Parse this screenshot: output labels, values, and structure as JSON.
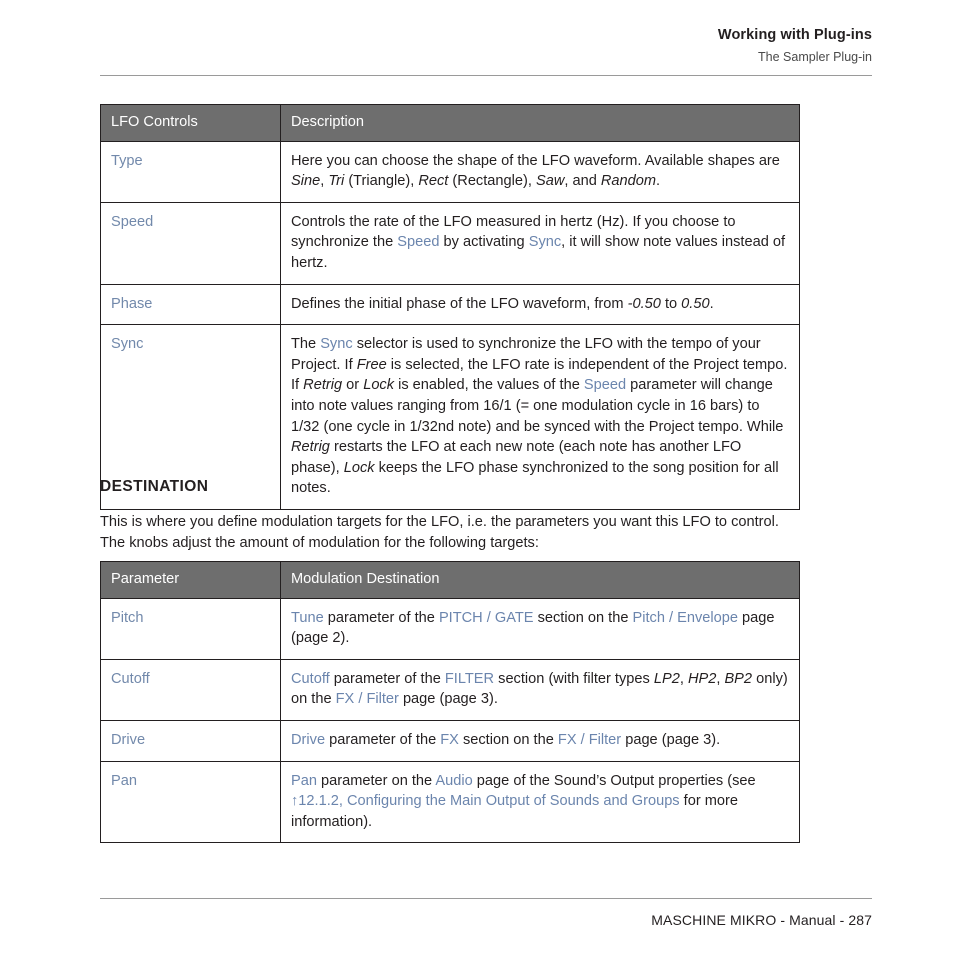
{
  "header": {
    "title": "Working with Plug-ins",
    "subtitle": "The Sampler Plug-in"
  },
  "colors": {
    "table_header_bg": "#6e6e6e",
    "table_header_text": "#ffffff",
    "link": "#6b85ad",
    "parameter": "#7289ab",
    "body_text": "#231f20",
    "rule": "#9a9a9a"
  },
  "lfo_table": {
    "headers": [
      "LFO Controls",
      "Description"
    ],
    "rows": [
      {
        "key": "Type",
        "desc_plain": "Here you can choose the shape of the LFO waveform. Available shapes are Sine, Tri (Triangle), Rect (Rectangle), Saw, and Random.",
        "parts": [
          {
            "t": "Here you can choose the shape of the LFO waveform. Available shapes are ",
            "s": "plain"
          },
          {
            "t": "Sine",
            "s": "italic"
          },
          {
            "t": ", ",
            "s": "plain"
          },
          {
            "t": "Tri",
            "s": "italic"
          },
          {
            "t": " (Triangle), ",
            "s": "plain"
          },
          {
            "t": "Rect",
            "s": "italic"
          },
          {
            "t": " (Rectangle), ",
            "s": "plain"
          },
          {
            "t": "Saw",
            "s": "italic"
          },
          {
            "t": ", and ",
            "s": "plain"
          },
          {
            "t": "Random",
            "s": "italic"
          },
          {
            "t": ".",
            "s": "plain"
          }
        ]
      },
      {
        "key": "Speed",
        "desc_plain": "Controls the rate of the LFO measured in hertz (Hz). If you choose to synchronize the Speed by activating Sync, it will show note values instead of hertz.",
        "parts": [
          {
            "t": "Controls the rate of the LFO measured in hertz (Hz). If you choose to synchronize the ",
            "s": "plain"
          },
          {
            "t": "Speed",
            "s": "link"
          },
          {
            "t": " by activating ",
            "s": "plain"
          },
          {
            "t": "Sync",
            "s": "link"
          },
          {
            "t": ", it will show note values instead of hertz.",
            "s": "plain"
          }
        ]
      },
      {
        "key": "Phase",
        "desc_plain": "Defines the initial phase of the LFO waveform, from -0.50 to 0.50.",
        "parts": [
          {
            "t": "Defines the initial phase of the LFO waveform, from ",
            "s": "plain"
          },
          {
            "t": "-0.50",
            "s": "italic"
          },
          {
            "t": " to ",
            "s": "plain"
          },
          {
            "t": "0.50",
            "s": "italic"
          },
          {
            "t": ".",
            "s": "plain"
          }
        ]
      },
      {
        "key": "Sync",
        "desc_plain": "The Sync selector is used to synchronize the LFO with the tempo of your Project. If Free is selected, the LFO rate is independent of the Project tempo. If Retrig or Lock is enabled, the values of the Speed parameter will change into note values ranging from 16/1 (= one modulation cycle in 16 bars) to 1/32 (one cycle in 1/32nd note) and be synced with the Project tempo. While Retrig restarts the LFO at each new note (each note has another LFO phase), Lock keeps the LFO phase synchronized to the song position for all notes.",
        "parts": [
          {
            "t": "The ",
            "s": "plain"
          },
          {
            "t": "Sync",
            "s": "link"
          },
          {
            "t": " selector is used to synchronize the LFO with the tempo of your Project. If ",
            "s": "plain"
          },
          {
            "t": "Free",
            "s": "italic"
          },
          {
            "t": " is selected, the LFO rate is independent of the Project tempo. If ",
            "s": "plain"
          },
          {
            "t": "Retrig",
            "s": "italic"
          },
          {
            "t": " or ",
            "s": "plain"
          },
          {
            "t": "Lock",
            "s": "italic"
          },
          {
            "t": " is enabled, the values of the ",
            "s": "plain"
          },
          {
            "t": "Speed",
            "s": "link"
          },
          {
            "t": " parameter will change into note values ranging from 16/1 (= one modulation cycle in 16 bars) to 1/32 (one cycle in 1/32nd note) and be synced with the Project tempo. While ",
            "s": "plain"
          },
          {
            "t": "Retrig",
            "s": "italic"
          },
          {
            "t": " restarts the LFO at each new note (each note has another LFO phase), ",
            "s": "plain"
          },
          {
            "t": "Lock",
            "s": "italic"
          },
          {
            "t": " keeps the LFO phase synchronized to the song position for all notes.",
            "s": "plain"
          }
        ]
      }
    ]
  },
  "destination": {
    "heading": "DESTINATION",
    "paragraph": "This is where you define modulation targets for the LFO, i.e. the parameters you want this LFO to control. The knobs adjust the amount of modulation for the following targets:"
  },
  "dest_table": {
    "headers": [
      "Parameter",
      "Modulation Destination"
    ],
    "rows": [
      {
        "key": "Pitch",
        "desc_plain": "Tune parameter of the PITCH / GATE section on the Pitch / Envelope page (page 2).",
        "parts": [
          {
            "t": "Tune",
            "s": "link"
          },
          {
            "t": " parameter of the ",
            "s": "plain"
          },
          {
            "t": "PITCH / GATE",
            "s": "link"
          },
          {
            "t": " section on the ",
            "s": "plain"
          },
          {
            "t": "Pitch / Envelope",
            "s": "link"
          },
          {
            "t": " page (page 2).",
            "s": "plain"
          }
        ]
      },
      {
        "key": "Cutoff",
        "desc_plain": "Cutoff parameter of the FILTER section (with filter types LP2, HP2, BP2 only) on the FX / Filter page (page 3).",
        "parts": [
          {
            "t": "Cutoff",
            "s": "link"
          },
          {
            "t": " parameter of the ",
            "s": "plain"
          },
          {
            "t": "FILTER",
            "s": "link"
          },
          {
            "t": " section (with filter types ",
            "s": "plain"
          },
          {
            "t": "LP2",
            "s": "italic"
          },
          {
            "t": ", ",
            "s": "plain"
          },
          {
            "t": "HP2",
            "s": "italic"
          },
          {
            "t": ", ",
            "s": "plain"
          },
          {
            "t": "BP2",
            "s": "italic"
          },
          {
            "t": " only) on the ",
            "s": "plain"
          },
          {
            "t": "FX / Filter",
            "s": "link"
          },
          {
            "t": " page (page 3).",
            "s": "plain"
          }
        ]
      },
      {
        "key": "Drive",
        "desc_plain": "Drive parameter of the FX section on the FX / Filter page (page 3).",
        "parts": [
          {
            "t": "Drive",
            "s": "link"
          },
          {
            "t": " parameter of the ",
            "s": "plain"
          },
          {
            "t": "FX",
            "s": "link"
          },
          {
            "t": " section on the ",
            "s": "plain"
          },
          {
            "t": "FX / Filter",
            "s": "link"
          },
          {
            "t": " page (page 3).",
            "s": "plain"
          }
        ]
      },
      {
        "key": "Pan",
        "desc_plain": "Pan parameter on the Audio page of the Sound’s Output properties (see ↑12.1.2, Configuring the Main Output of Sounds and Groups for more information).",
        "parts": [
          {
            "t": "Pan",
            "s": "link"
          },
          {
            "t": " parameter on the ",
            "s": "plain"
          },
          {
            "t": "Audio",
            "s": "link"
          },
          {
            "t": " page of the Sound’s Output properties (see ",
            "s": "plain"
          },
          {
            "t": "↑12.1.2, Configuring the Main Output of Sounds and Groups",
            "s": "link"
          },
          {
            "t": " for more information).",
            "s": "plain"
          }
        ]
      }
    ]
  },
  "footer": {
    "text": "MASCHINE MIKRO - Manual - 287"
  }
}
